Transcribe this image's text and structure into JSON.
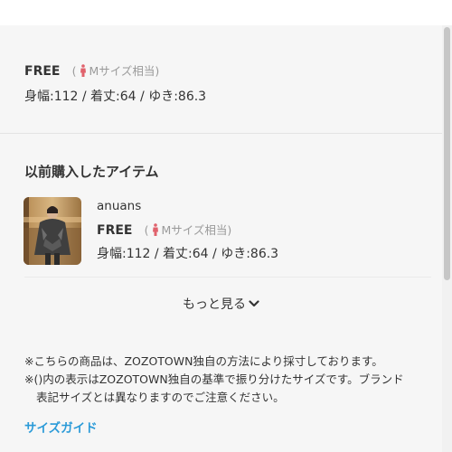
{
  "current_size": {
    "label": "FREE",
    "equiv_open": "(",
    "equiv_text": "Mサイズ相当",
    "equiv_close": ")",
    "measurements": "身幅:112 / 着丈:64 / ゆき:86.3"
  },
  "purchased_section": {
    "title": "以前購入したアイテム",
    "items": [
      {
        "brand": "anuans",
        "size_label": "FREE",
        "equiv_open": "(",
        "equiv_text": "Mサイズ相当",
        "equiv_close": ")",
        "measurements": "身幅:112 / 着丈:64 / ゆき:86.3"
      }
    ],
    "more_label": "もっと見る"
  },
  "notes": [
    "※こちらの商品は、ZOZOTOWN独自の方法により採寸しております。",
    "※()内の表示はZOZOTOWN独自の基準で振り分けたサイズです。ブランド",
    "表記サイズとは異なりますのでご注意ください。"
  ],
  "size_guide_link": "サイズガイド",
  "colors": {
    "panel_bg": "#f6f6f6",
    "link": "#2a9ad8",
    "person_icon": "#e0626c",
    "muted": "#9a9a9a"
  },
  "icons": [
    "person-icon",
    "chevron-down-icon"
  ]
}
